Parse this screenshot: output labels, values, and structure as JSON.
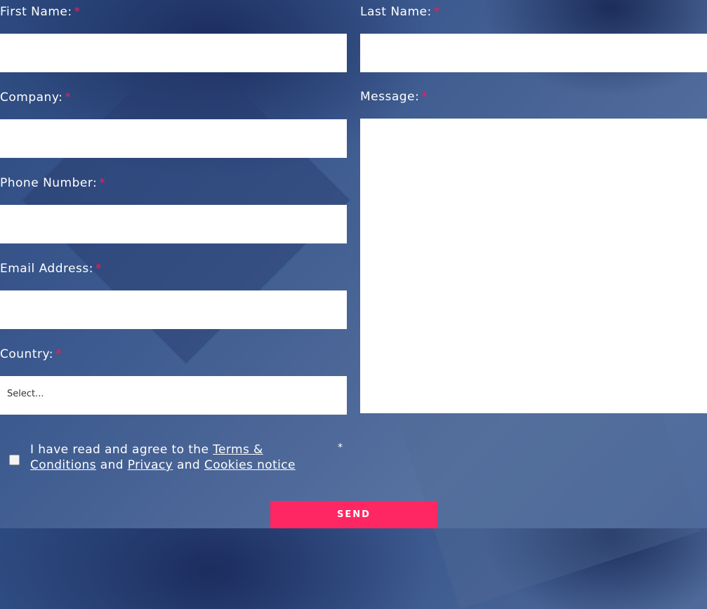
{
  "form": {
    "required_mark": "*",
    "first_name_label": "First Name:",
    "last_name_label": "Last Name:",
    "company_label": "Company:",
    "message_label": "Message:",
    "phone_label": "Phone Number:",
    "email_label": "Email Address:",
    "country_label": "Country:",
    "country_selected": "Select...",
    "consent": {
      "text_1": "I have read and agree to the ",
      "terms_link": "Terms & Conditions",
      "and_1": " and ",
      "privacy_link": "Privacy",
      "and_2": " and ",
      "cookies_link": "Cookies notice"
    },
    "send_label": "SEND"
  },
  "colors": {
    "accent": "#ff2763",
    "required": "#e0245e",
    "background": "#3c5a8f"
  }
}
